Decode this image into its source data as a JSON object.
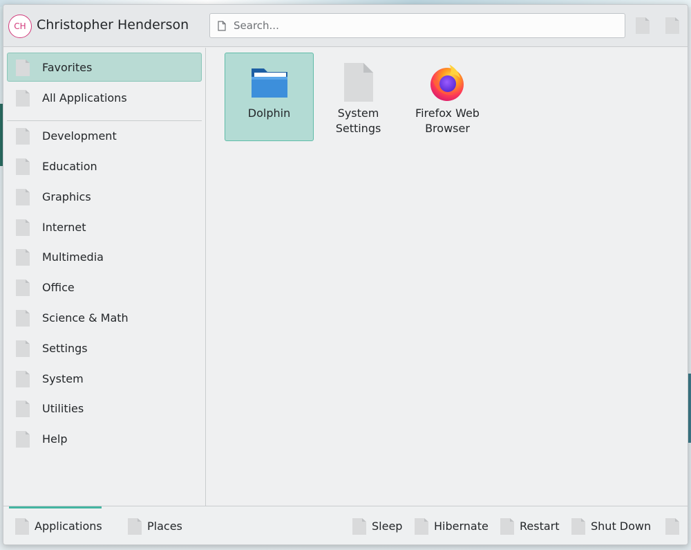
{
  "header": {
    "avatar_initials": "CH",
    "username": "Christopher Henderson",
    "search_placeholder": "Search..."
  },
  "sidebar": {
    "items": [
      {
        "label": "Favorites",
        "icon": "document-placeholder-icon",
        "active": true
      },
      {
        "label": "All Applications",
        "icon": "document-placeholder-icon"
      },
      {
        "label": "Development",
        "icon": "document-placeholder-icon"
      },
      {
        "label": "Education",
        "icon": "document-placeholder-icon"
      },
      {
        "label": "Graphics",
        "icon": "document-placeholder-icon"
      },
      {
        "label": "Internet",
        "icon": "document-placeholder-icon"
      },
      {
        "label": "Multimedia",
        "icon": "document-placeholder-icon"
      },
      {
        "label": "Office",
        "icon": "document-placeholder-icon"
      },
      {
        "label": "Science & Math",
        "icon": "document-placeholder-icon"
      },
      {
        "label": "Settings",
        "icon": "document-placeholder-icon"
      },
      {
        "label": "System",
        "icon": "document-placeholder-icon"
      },
      {
        "label": "Utilities",
        "icon": "document-placeholder-icon"
      },
      {
        "label": "Help",
        "icon": "document-placeholder-icon"
      }
    ]
  },
  "favorites": [
    {
      "label": "Dolphin",
      "icon": "folder-icon",
      "active": true
    },
    {
      "label": "System Settings",
      "icon": "document-placeholder-icon"
    },
    {
      "label": "Firefox Web Browser",
      "icon": "firefox-icon"
    }
  ],
  "footer": {
    "tabs": [
      {
        "label": "Applications",
        "active": true
      },
      {
        "label": "Places"
      }
    ],
    "power": [
      {
        "label": "Sleep"
      },
      {
        "label": "Hibernate"
      },
      {
        "label": "Restart"
      },
      {
        "label": "Shut Down"
      }
    ]
  },
  "colors": {
    "accent": "#44b5a1",
    "selection": "#b9dbd4",
    "avatar_ring": "#d2397a"
  }
}
